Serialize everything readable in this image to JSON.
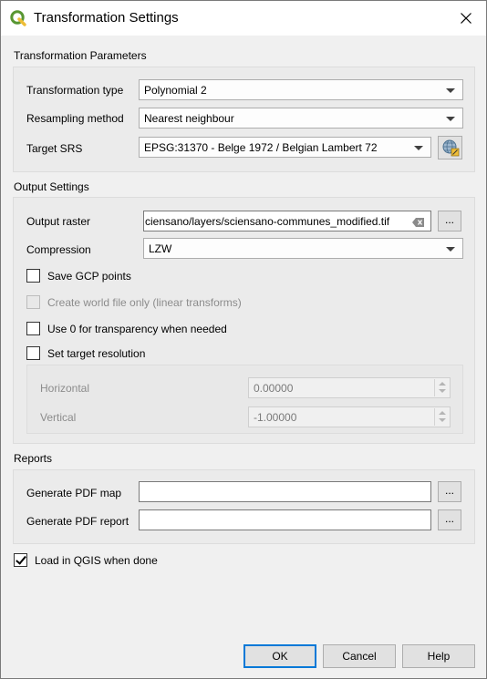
{
  "window": {
    "title": "Transformation Settings",
    "app_icon": "qgis-logo-icon",
    "close_icon": "close-icon"
  },
  "transformation": {
    "section_title": "Transformation Parameters",
    "type_label": "Transformation type",
    "type_value": "Polynomial 2",
    "resampling_label": "Resampling method",
    "resampling_value": "Nearest neighbour",
    "srs_label": "Target SRS",
    "srs_value": "EPSG:31370 - Belge 1972 / Belgian Lambert 72",
    "srs_button_icon": "projection-globe-icon"
  },
  "output": {
    "section_title": "Output Settings",
    "raster_label": "Output raster",
    "raster_value": "ciensano/layers/sciensano-communes_modified.tif",
    "browse_label": "...",
    "compression_label": "Compression",
    "compression_value": "LZW",
    "save_gcp_label": "Save GCP points",
    "save_gcp_checked": false,
    "world_file_label": "Create world file only (linear transforms)",
    "world_file_checked": false,
    "transparency_label": "Use 0 for transparency when needed",
    "transparency_checked": false,
    "target_res_label": "Set target resolution",
    "target_res_checked": false,
    "horizontal_label": "Horizontal",
    "horizontal_value": "0.00000",
    "vertical_label": "Vertical",
    "vertical_value": "-1.00000"
  },
  "reports": {
    "section_title": "Reports",
    "pdf_map_label": "Generate PDF map",
    "pdf_map_value": "",
    "pdf_report_label": "Generate PDF report",
    "pdf_report_value": "",
    "browse_label": "..."
  },
  "load_in_qgis": {
    "label": "Load in QGIS when done",
    "checked": true
  },
  "buttons": {
    "ok": "OK",
    "cancel": "Cancel",
    "help": "Help"
  },
  "colors": {
    "accent": "#0078d7",
    "qgis_green": "#589632",
    "qgis_yellow": "#eebd37"
  }
}
